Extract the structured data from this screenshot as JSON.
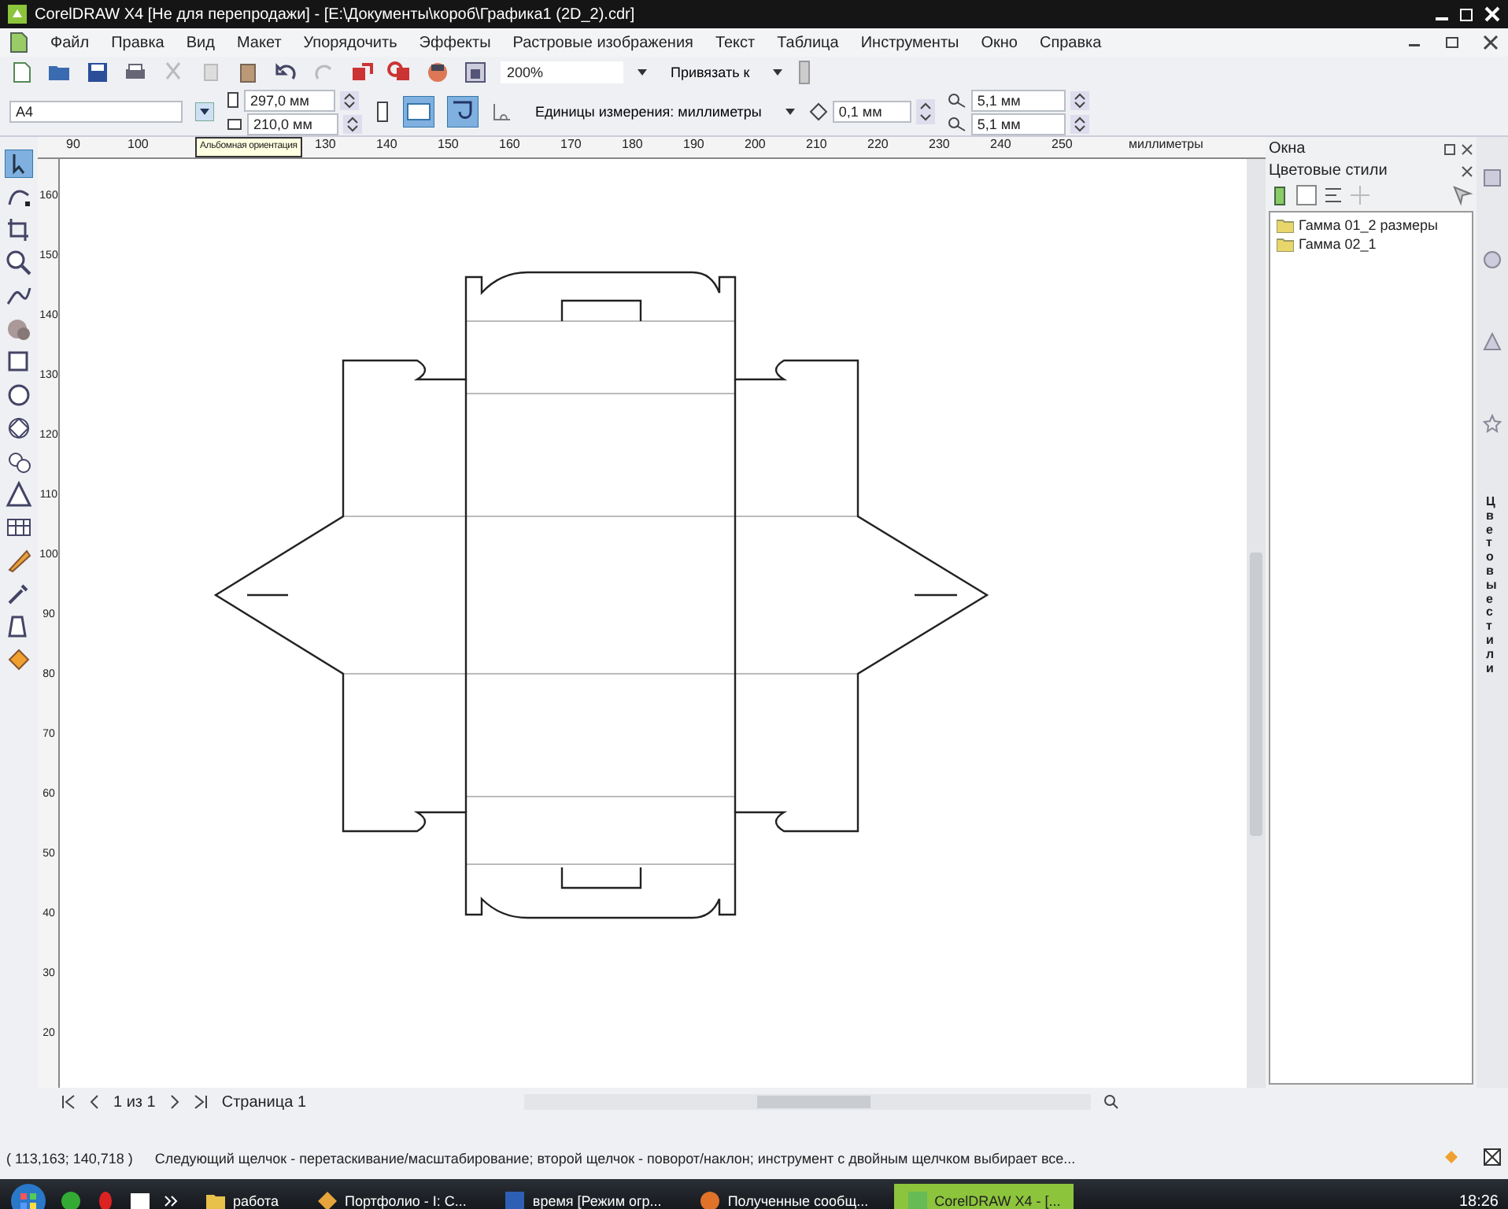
{
  "window": {
    "title": "CorelDRAW X4 [Не для перепродажи] - [E:\\Документы\\короб\\Графика1 (2D_2).cdr]"
  },
  "menu": [
    "Файл",
    "Правка",
    "Вид",
    "Макет",
    "Упорядочить",
    "Эффекты",
    "Растровые изображения",
    "Текст",
    "Таблица",
    "Инструменты",
    "Окно",
    "Справка"
  ],
  "toolbar": {
    "zoom": "200%",
    "snap": "Привязать к"
  },
  "property_bar": {
    "page_size": "A4",
    "width": "297,0 мм",
    "height": "210,0 мм",
    "units": "Единицы измерения: миллиметры",
    "nudge": "0,1 мм",
    "dup_x": "5,1 мм",
    "dup_y": "5,1 мм"
  },
  "tooltip": "Альбомная ориентация",
  "ruler": {
    "h_ticks": [
      "90",
      "100",
      "130",
      "140",
      "150",
      "160",
      "170",
      "180",
      "190",
      "200",
      "210",
      "220",
      "230",
      "240",
      "250"
    ],
    "unit": "миллиметры",
    "v_ticks": [
      "160",
      "150",
      "140",
      "130",
      "120",
      "110",
      "100",
      "90",
      "80",
      "70",
      "60",
      "50",
      "40",
      "30",
      "20"
    ]
  },
  "docker": {
    "title": "Окна",
    "panel": "Цветовые стили",
    "items": [
      {
        "label": "Гамма 01_2 размеры",
        "selected": false
      },
      {
        "label": "Гамма 02_1",
        "selected": false
      }
    ],
    "side_tab": "Цветовые стили"
  },
  "page_nav": {
    "counter": "1 из 1",
    "tab": "Страница 1"
  },
  "status": {
    "coords": "( 113,163; 140,718 )",
    "hint": "Следующий щелчок - перетаскивание/масштабирование; второй щелчок - поворот/наклон; инструмент с двойным щелчком выбирает все..."
  },
  "taskbar": {
    "items": [
      {
        "label": "работа",
        "active": false
      },
      {
        "label": "Портфолио - I: C...",
        "active": false
      },
      {
        "label": "время [Режим огр...",
        "active": false
      },
      {
        "label": "Полученные сообщ...",
        "active": false
      },
      {
        "label": "CorelDRAW X4 - [...",
        "active": true
      }
    ],
    "clock": "18:26"
  }
}
